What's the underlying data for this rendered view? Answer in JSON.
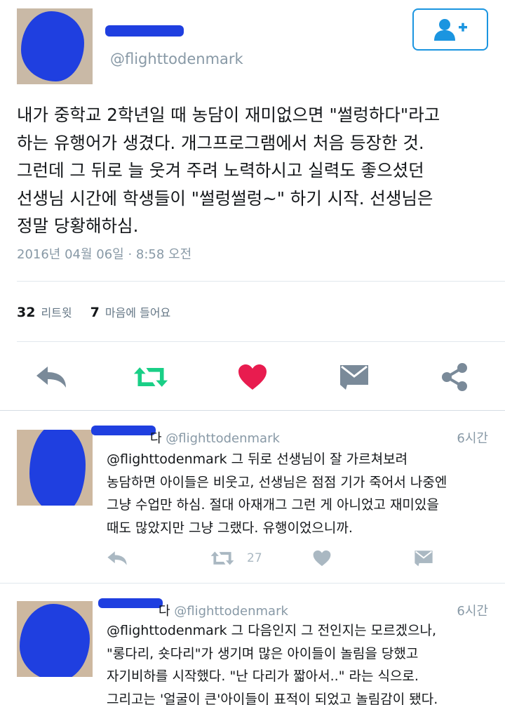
{
  "header": {
    "handle": "@flighttodenmark",
    "follow_icon": "add-user-icon"
  },
  "tweet": {
    "text": "내가 중학교 2학년일 때 농담이 재미없으면 \"썰렁하다\"라고\n하는 유행어가 생겼다. 개그프로그램에서 처음 등장한 것.\n그런데 그 뒤로 늘 웃겨 주려 노력하시고 실력도 좋으셨던\n선생님 시간에 학생들이 \"썰렁썰렁~\" 하기 시작. 선생님은\n정말 당황해하심.",
    "timestamp": "2016년 04월 06일 · 8:58 오전",
    "retweet_count": "32",
    "retweet_label": "리트윗",
    "like_count": "7",
    "like_label": "마음에 들어요"
  },
  "actions": {
    "reply_icon": "reply-icon",
    "retweet_icon": "retweet-icon",
    "like_icon": "heart-icon",
    "dm_icon": "envelope-icon",
    "share_icon": "share-icon"
  },
  "replies": [
    {
      "name_fragment": "다",
      "handle": "@flighttodenmark",
      "time": "6시간",
      "text": "@flighttodenmark 그 뒤로 선생님이 잘 가르쳐보려\n농담하면 아이들은 비웃고, 선생님은 점점 기가 죽어서 나중엔\n그냥 수업만 하심. 절대 아재개그 그런 게 아니었고 재미있을\n때도 많았지만 그냥 그랬다. 유행이었으니까.",
      "retweet_count": "27"
    },
    {
      "name_fragment": "다",
      "handle": "@flighttodenmark",
      "time": "6시간",
      "text": "@flighttodenmark 그 다음인지 그 전인지는 모르겠으나,\n\"롱다리, 숏다리\"가 생기며 많은 아이들이 놀림을 당했고\n자기비하를 시작했다. \"난 다리가 짧아서..\" 라는 식으로.\n그리고는 '얼굴이 큰'아이들이 표적이 되었고 놀림감이 됐다."
    }
  ],
  "colors": {
    "accent": "#1b95e0",
    "retweet_green": "#19cf86",
    "like_red": "#e81c4f",
    "icon_gray": "#7a8a99",
    "muted_gray": "#aab8c2",
    "redaction_blue": "#1f3fe0"
  }
}
